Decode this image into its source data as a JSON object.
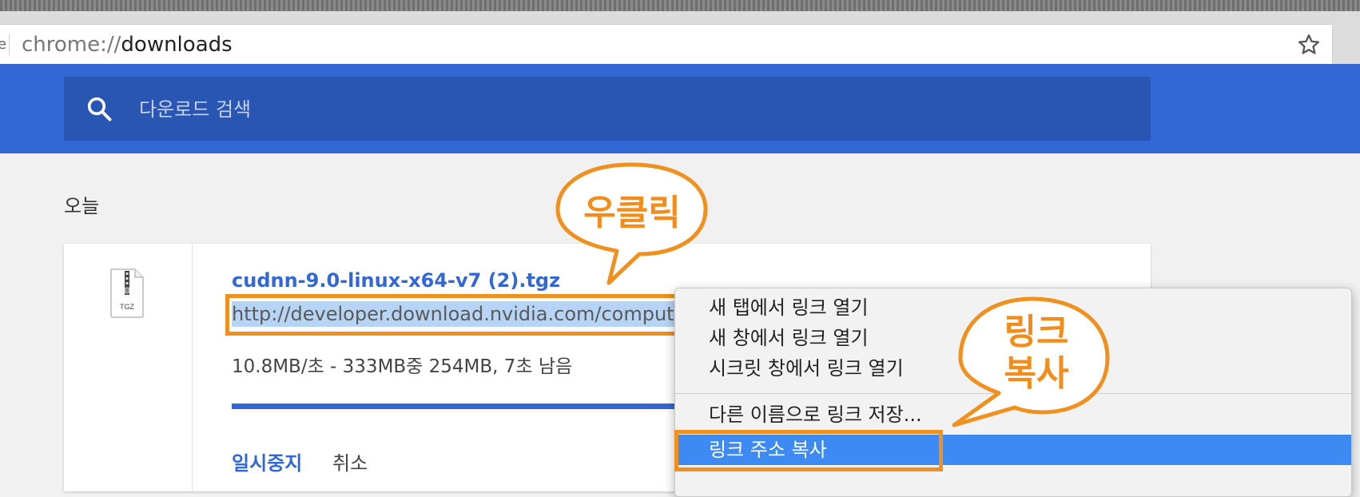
{
  "browser": {
    "url_scheme": "chrome://",
    "url_path": "downloads"
  },
  "search": {
    "placeholder": "다운로드 검색"
  },
  "section": {
    "title": "오늘"
  },
  "download": {
    "file_type": "TGZ",
    "filename": "cudnn-9.0-linux-x64-v7 (2).tgz",
    "url": "http://developer.download.nvidia.com/compute/",
    "status": "10.8MB/초 - 333MB중 254MB, 7초 남음",
    "progress": 0.763,
    "pause_label": "일시중지",
    "cancel_label": "취소"
  },
  "context_menu": {
    "items": [
      "새 탭에서 링크 열기",
      "새 창에서 링크 열기",
      "시크릿 창에서 링크 열기",
      "다른 이름으로 링크 저장...",
      "링크 주소 복사"
    ],
    "selected_index": 4
  },
  "annotations": {
    "right_click": "우클릭",
    "copy_link": "링크\n복사"
  },
  "colors": {
    "accent": "#3367d6",
    "annotation": "#f0901e",
    "menu_selection": "#3d8bf2"
  }
}
